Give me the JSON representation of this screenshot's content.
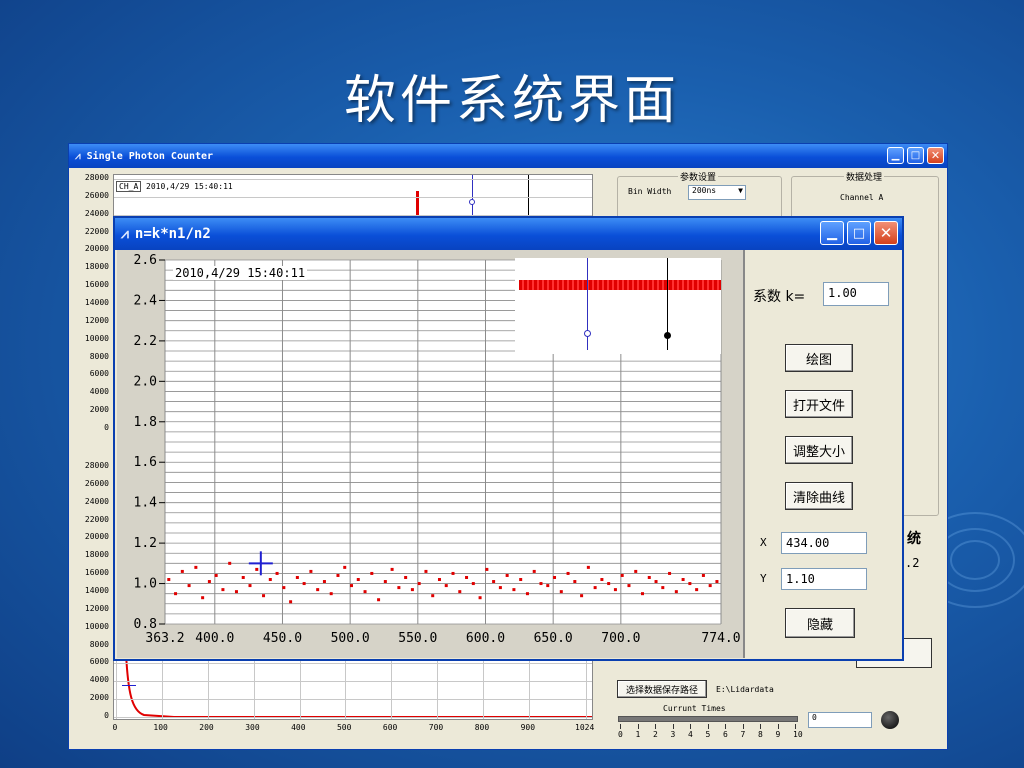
{
  "slide": {
    "title": "软件系统界面"
  },
  "main_window": {
    "title": "Single Photon Counter",
    "top_chart": {
      "y_ticks": [
        "28000",
        "26000",
        "24000",
        "22000",
        "20000",
        "18000",
        "16000",
        "14000",
        "12000",
        "10000",
        "8000",
        "6000",
        "4000",
        "2000",
        "0"
      ],
      "legend": "CH_A",
      "timestamp": "2010,4/29  15:40:11"
    },
    "bottom_chart": {
      "y_ticks": [
        "28000",
        "26000",
        "24000",
        "22000",
        "20000",
        "18000",
        "16000",
        "14000",
        "12000",
        "10000",
        "8000",
        "6000",
        "4000",
        "2000",
        "0"
      ],
      "x_ticks": [
        "0",
        "100",
        "200",
        "300",
        "400",
        "500",
        "600",
        "700",
        "800",
        "900",
        "1024"
      ]
    },
    "params_group": {
      "title": "参数设置",
      "bin_width_label": "Bin Width",
      "bin_width_value": "200ns"
    },
    "data_group": {
      "title": "数据处理",
      "channel": "Channel A"
    },
    "partial_text": {
      "tong": "统",
      "num": ".2"
    },
    "save_path_button": "选择数据保存路径",
    "save_path_value": "E:\\Lidardata",
    "current_times_label": "Currunt Times",
    "slider_ticks": [
      "0",
      "1",
      "2",
      "3",
      "4",
      "5",
      "6",
      "7",
      "8",
      "9",
      "10"
    ],
    "current_times_value": "0"
  },
  "dialog": {
    "title": "n=k*n1/n2",
    "timestamp": "2010,4/29  15:40:11",
    "coef_label": "系数 k=",
    "coef_value": "1.00",
    "buttons": {
      "plot": "绘图",
      "open": "打开文件",
      "resize": "调整大小",
      "clear": "清除曲线",
      "hide": "隐藏"
    },
    "x_label": "X",
    "x_value": "434.00",
    "y_label": "Y",
    "y_value": "1.10"
  },
  "chart_data": {
    "type": "scatter",
    "title": "",
    "xlabel": "",
    "ylabel": "",
    "xlim": [
      363.2,
      774.0
    ],
    "ylim": [
      0.8,
      2.6
    ],
    "x_tick_labels": [
      "363.2",
      "400.0",
      "450.0",
      "500.0",
      "550.0",
      "600.0",
      "650.0",
      "700.0",
      "774.0"
    ],
    "x_tick_values": [
      363.2,
      400,
      450,
      500,
      550,
      600,
      650,
      700,
      774
    ],
    "y_tick_labels": [
      "2.6",
      "2.4",
      "2.2",
      "2.0",
      "1.8",
      "1.6",
      "1.4",
      "1.2",
      "1.0",
      "0.8"
    ],
    "y_tick_values": [
      2.6,
      2.4,
      2.2,
      2.0,
      1.8,
      1.6,
      1.4,
      1.2,
      1.0,
      0.8
    ],
    "grid": true,
    "series_color": "#e00000",
    "cursor": {
      "x": 434.0,
      "y": 1.1,
      "color": "#2020d0"
    },
    "series": [
      {
        "x": [
          366,
          371,
          376,
          381,
          386,
          391,
          396,
          401,
          406,
          411,
          416,
          421,
          426,
          431,
          436,
          441,
          446,
          451,
          456,
          461,
          466,
          471,
          476,
          481,
          486,
          491,
          496,
          501,
          506,
          511,
          516,
          521,
          526,
          531,
          536,
          541,
          546,
          551,
          556,
          561,
          566,
          571,
          576,
          581,
          586,
          591,
          596,
          601,
          606,
          611,
          616,
          621,
          626,
          631,
          636,
          641,
          646,
          651,
          656,
          661,
          666,
          671,
          676,
          681,
          686,
          691,
          696,
          701,
          706,
          711,
          716,
          721,
          726,
          731,
          736,
          741,
          746,
          751,
          756,
          761,
          766,
          771
        ],
        "y": [
          1.02,
          0.95,
          1.06,
          0.99,
          1.08,
          0.93,
          1.01,
          1.04,
          0.97,
          1.1,
          0.96,
          1.03,
          0.99,
          1.07,
          0.94,
          1.02,
          1.05,
          0.98,
          0.91,
          1.03,
          1.0,
          1.06,
          0.97,
          1.01,
          0.95,
          1.04,
          1.08,
          0.99,
          1.02,
          0.96,
          1.05,
          0.92,
          1.01,
          1.07,
          0.98,
          1.03,
          0.97,
          1.0,
          1.06,
          0.94,
          1.02,
          0.99,
          1.05,
          0.96,
          1.03,
          1.0,
          0.93,
          1.07,
          1.01,
          0.98,
          1.04,
          0.97,
          1.02,
          0.95,
          1.06,
          1.0,
          0.99,
          1.03,
          0.96,
          1.05,
          1.01,
          0.94,
          1.08,
          0.98,
          1.02,
          1.0,
          0.97,
          1.04,
          0.99,
          1.06,
          0.95,
          1.03,
          1.01,
          0.98,
          1.05,
          0.96,
          1.02,
          1.0,
          0.97,
          1.04,
          0.99,
          1.01
        ]
      }
    ]
  }
}
